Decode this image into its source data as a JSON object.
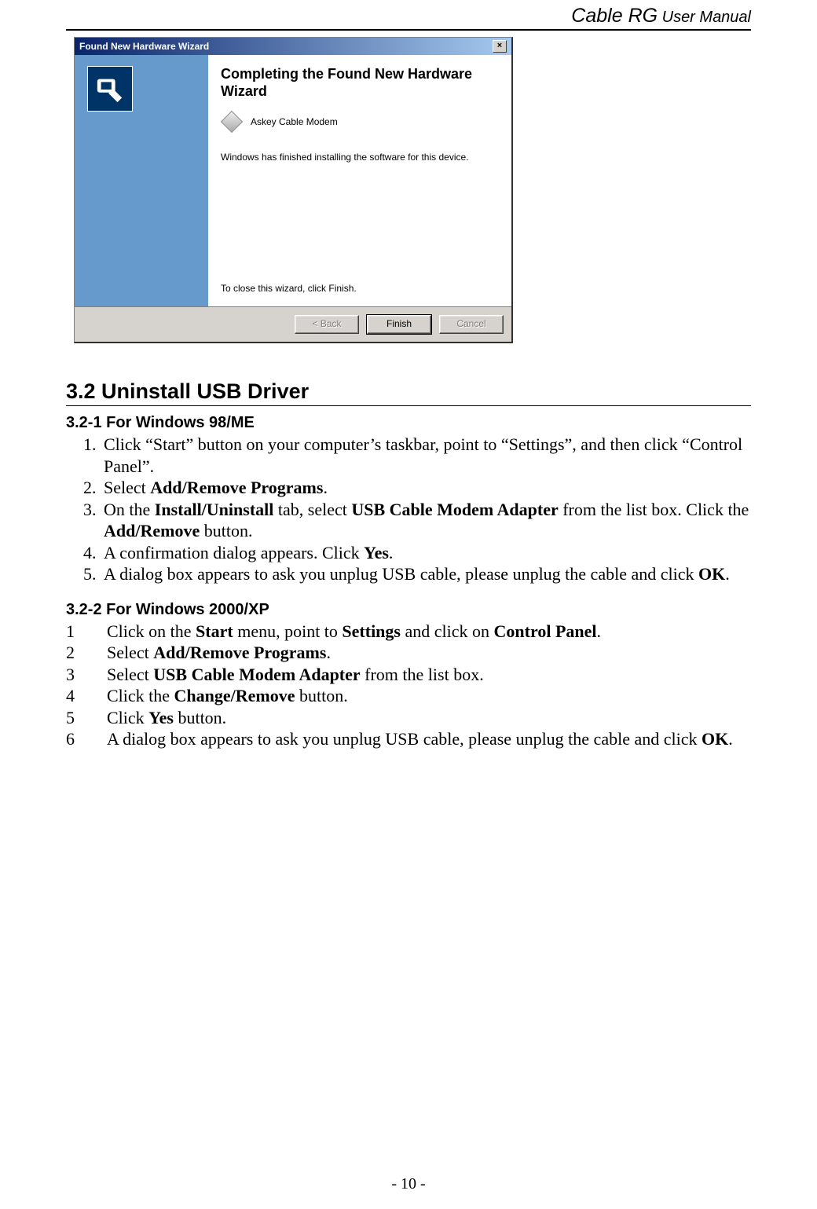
{
  "header": {
    "brand": "Cable RG",
    "suffix": " User Manual"
  },
  "wizard": {
    "title": "Found New Hardware Wizard",
    "heading": "Completing the Found New Hardware Wizard",
    "device": "Askey Cable Modem",
    "message": "Windows has finished installing the software for this device.",
    "closeMsg": "To close this wizard, click Finish.",
    "back": "< Back",
    "finish": "Finish",
    "cancel": "Cancel"
  },
  "sectionTitle": "3.2 Uninstall USB Driver",
  "sub1": {
    "title": "3.2-1 For Windows 98/ME",
    "items": [
      "Click “Start” button on your computer’s taskbar, point to “Settings”, and then click “Control Panel”.",
      "Select <b>Add/Remove Programs</b>.",
      "On the <b>Install/Uninstall</b> tab, select <b>USB Cable Modem Adapter</b> from the list box. Click the <b>Add/Remove</b> button.",
      "A confirmation dialog appears. Click <b>Yes</b>.",
      "A dialog box appears to ask you unplug USB cable, please unplug the cable and click <b>OK</b>."
    ]
  },
  "sub2": {
    "title": "3.2-2 For Windows 2000/XP",
    "items": [
      "Click on the <b>Start</b> menu, point to <b>Settings</b> and click on <b>Control Panel</b>.",
      "Select <b>Add/Remove Programs</b>.",
      "Select <b>USB Cable Modem Adapter</b> from the list box.",
      "Click the <b>Change/Remove</b> button.",
      "Click <b>Yes</b> button.",
      "A dialog box appears to ask you unplug USB cable, please unplug the cable and click <b>OK</b>."
    ]
  },
  "pageNumber": "- 10 -"
}
